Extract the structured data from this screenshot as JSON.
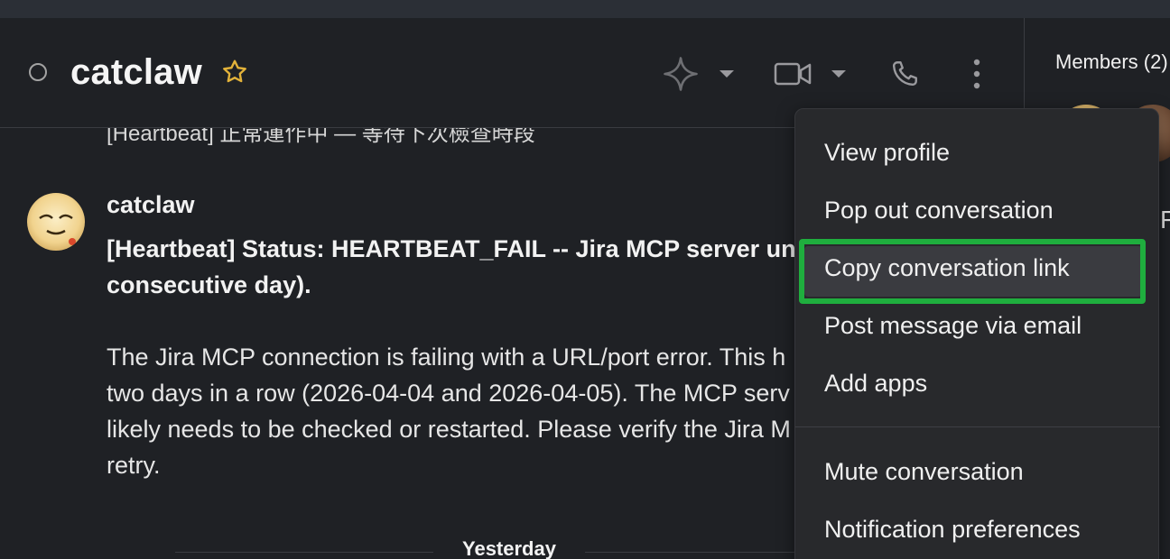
{
  "header": {
    "title": "catclaw"
  },
  "members": {
    "label": "Members (2)",
    "side_letter": "F"
  },
  "conversation": {
    "cut_line": "[Heartbeat] 正常運作中 — 等待下次檢查時段",
    "message": {
      "author": "catclaw",
      "heartbeat_line1": "[Heartbeat] Status: HEARTBEAT_FAIL -- Jira MCP server unre",
      "heartbeat_line2": "consecutive day).",
      "body_line1": "The Jira MCP connection is failing with a URL/port error. This h",
      "body_line2": "two days in a row (2026-04-04 and 2026-04-05). The MCP serv",
      "body_line3": "likely needs to be checked or restarted. Please verify the Jira M",
      "body_line4": "retry."
    },
    "day_divider": "Yesterday"
  },
  "menu": {
    "items": [
      {
        "label": "View profile"
      },
      {
        "label": "Pop out conversation"
      },
      {
        "label": "Copy conversation link"
      },
      {
        "label": "Post message via email"
      },
      {
        "label": "Add apps"
      },
      {
        "label": "Mute conversation"
      },
      {
        "label": "Notification preferences"
      }
    ],
    "highlight_color": "#1fae3e"
  },
  "icons": {
    "status": "presence-away-icon",
    "star": "star-icon",
    "ai": "sparkle-icon",
    "video": "video-camera-icon",
    "phone": "phone-icon",
    "more": "more-vertical-icon"
  },
  "colors": {
    "background": "#1f2125",
    "menu_background": "#28292c",
    "star": "#e2b23a"
  }
}
